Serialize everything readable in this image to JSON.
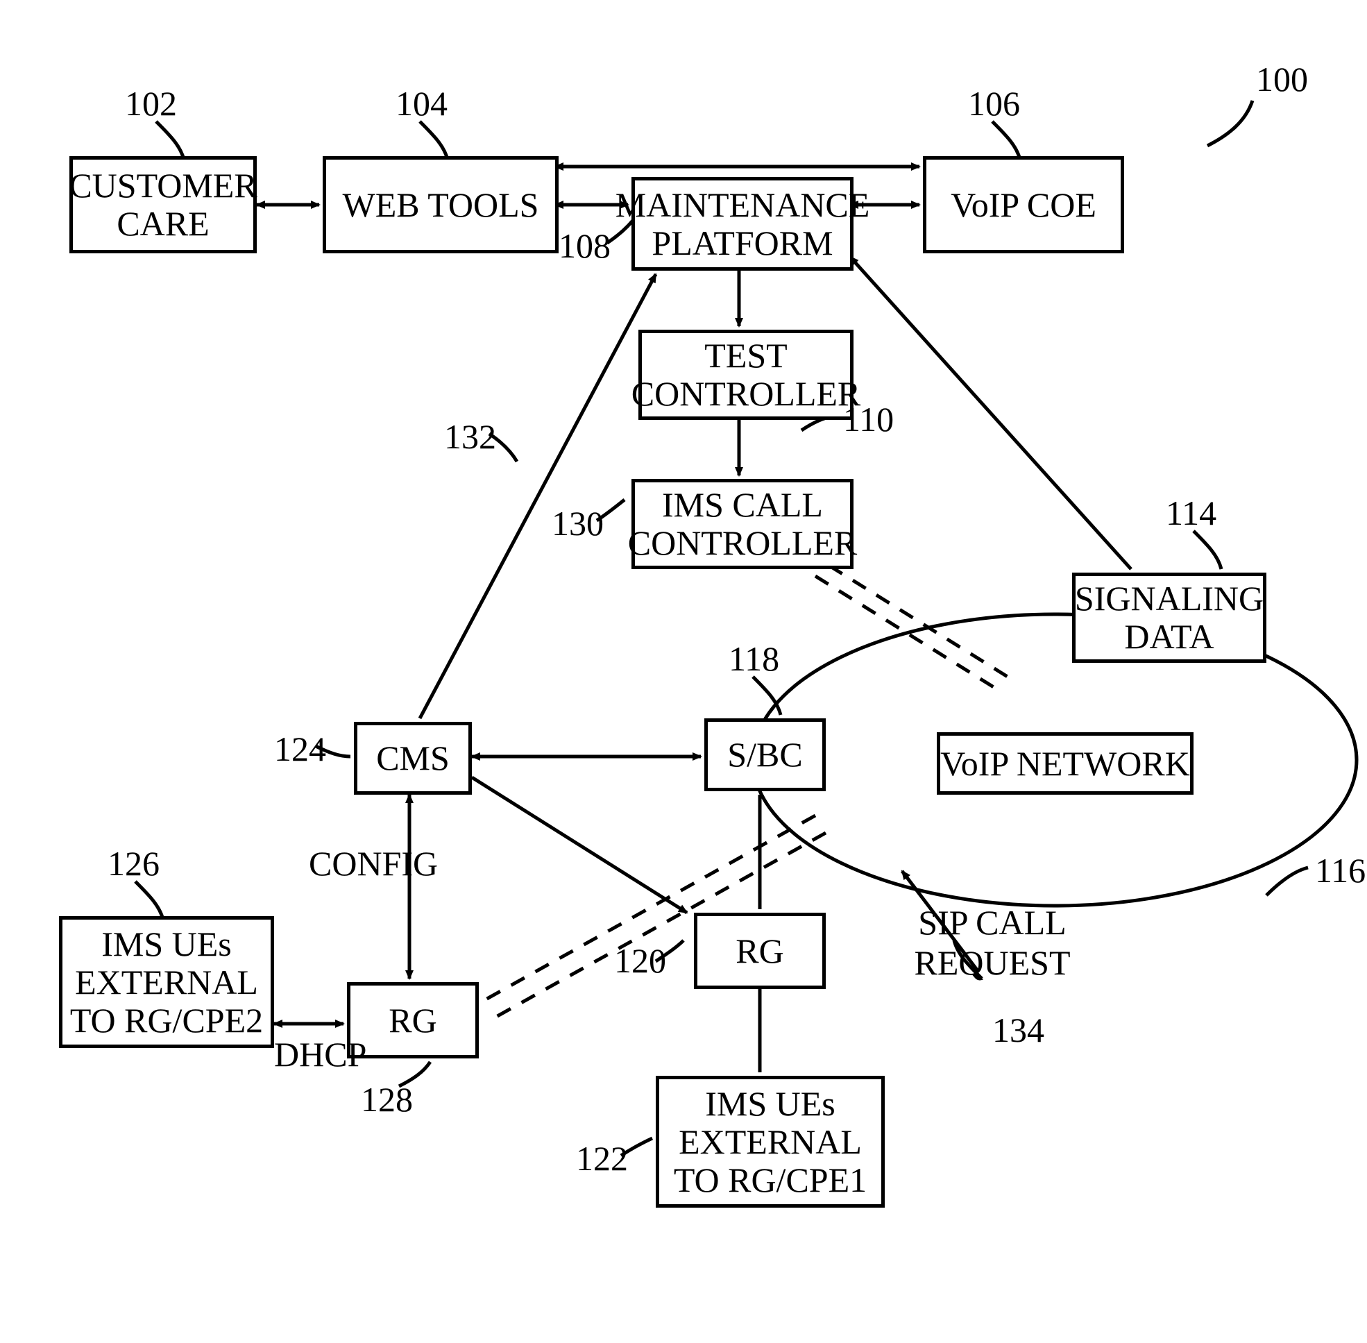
{
  "refs": {
    "sys": "100",
    "custcare": "102",
    "webtools": "104",
    "voipcoe": "106",
    "maint": "108",
    "testctl": "110",
    "signal": "114",
    "voipnet": "116",
    "sbc": "118",
    "rg1": "120",
    "ue1": "122",
    "cms": "124",
    "ue2": "126",
    "rg2": "128",
    "imscc": "130",
    "cms_maint": "132",
    "sipreq": "134"
  },
  "labels": {
    "custcare": "CUSTOMER CARE",
    "webtools": "WEB TOOLS",
    "voipcoe": "VoIP COE",
    "maint": "MAINTENANCE PLATFORM",
    "testctl": "TEST CONTROLLER",
    "imscc": "IMS CALL CONTROLLER",
    "signal": "SIGNALING DATA",
    "voipnet": "VoIP NETWORK",
    "sbc": "S/BC",
    "rg1": "RG",
    "ue1": "IMS UEs EXTERNAL TO RG/CPE1",
    "cms": "CMS",
    "rg2": "RG",
    "ue2": "IMS UEs EXTERNAL TO RG/CPE2",
    "config": "CONFIG",
    "dhcp": "DHCP",
    "sipreq": "SIP CALL REQUEST"
  }
}
